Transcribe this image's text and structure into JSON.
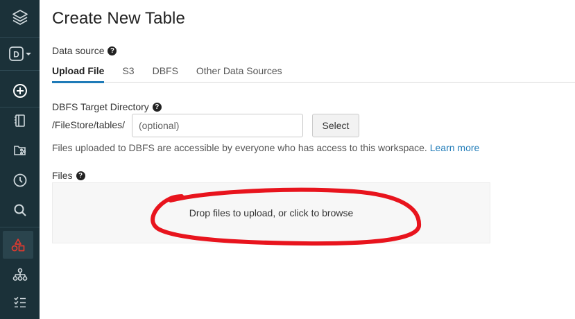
{
  "sidebar": {
    "items": [
      {
        "name": "databricks-logo-icon"
      },
      {
        "name": "workspace-switcher-icon",
        "label": "D"
      },
      {
        "name": "create-icon"
      },
      {
        "name": "notebook-icon"
      },
      {
        "name": "repos-icon"
      },
      {
        "name": "recents-icon"
      },
      {
        "name": "search-icon"
      },
      {
        "name": "data-icon",
        "active": true,
        "accent": "#e03a2f"
      },
      {
        "name": "clusters-icon"
      },
      {
        "name": "jobs-icon"
      }
    ]
  },
  "page": {
    "title": "Create New Table"
  },
  "data_source": {
    "label": "Data source",
    "help_icon": "question-circle-icon",
    "tabs": [
      {
        "label": "Upload File",
        "active": true
      },
      {
        "label": "S3",
        "active": false
      },
      {
        "label": "DBFS",
        "active": false
      },
      {
        "label": "Other Data Sources",
        "active": false
      }
    ]
  },
  "target_directory": {
    "label": "DBFS Target Directory",
    "prefix": "/FileStore/tables/",
    "placeholder": "(optional)",
    "value": "",
    "select_label": "Select"
  },
  "info": {
    "text": "Files uploaded to DBFS are accessible by everyone who has access to this workspace.",
    "link": "Learn more"
  },
  "files": {
    "label": "Files",
    "dropzone_text": "Drop files to upload, or click to browse"
  },
  "colors": {
    "sidebar_bg": "#1b3139",
    "accent": "#1f7bb8",
    "annotation": "#e8141d"
  }
}
